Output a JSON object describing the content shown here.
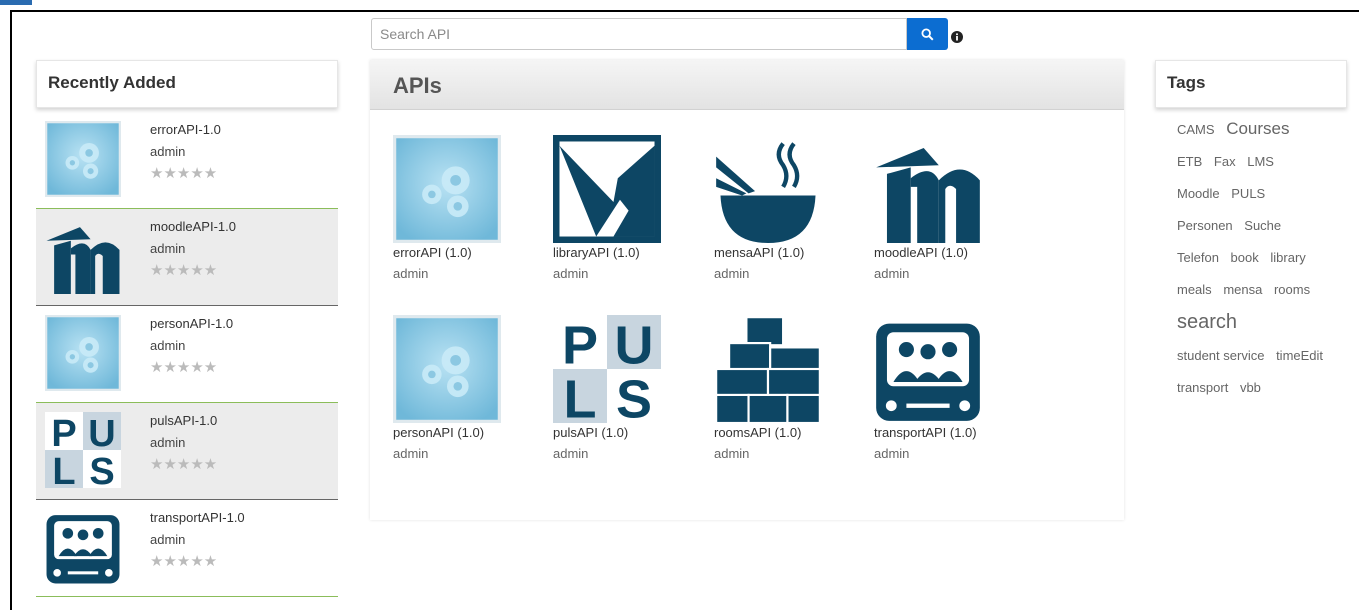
{
  "search": {
    "placeholder": "Search API",
    "button_icon": "search-icon"
  },
  "recent": {
    "title": "Recently Added",
    "items": [
      {
        "name": "errorAPI-1.0",
        "owner": "admin",
        "stars": "★★★★★",
        "icon": "gears"
      },
      {
        "name": "moodleAPI-1.0",
        "owner": "admin",
        "stars": "★★★★★",
        "icon": "moodle"
      },
      {
        "name": "personAPI-1.0",
        "owner": "admin",
        "stars": "★★★★★",
        "icon": "gears"
      },
      {
        "name": "pulsAPI-1.0",
        "owner": "admin",
        "stars": "★★★★★",
        "icon": "puls"
      },
      {
        "name": "transportAPI-1.0",
        "owner": "admin",
        "stars": "★★★★★",
        "icon": "bus"
      }
    ]
  },
  "apis": {
    "title": "APIs",
    "tiles": [
      {
        "name": "errorAPI (1.0)",
        "owner": "admin",
        "icon": "gears"
      },
      {
        "name": "libraryAPI (1.0)",
        "owner": "admin",
        "icon": "library"
      },
      {
        "name": "mensaAPI (1.0)",
        "owner": "admin",
        "icon": "bowl"
      },
      {
        "name": "moodleAPI (1.0)",
        "owner": "admin",
        "icon": "moodle"
      },
      {
        "name": "personAPI (1.0)",
        "owner": "admin",
        "icon": "gears"
      },
      {
        "name": "pulsAPI (1.0)",
        "owner": "admin",
        "icon": "puls"
      },
      {
        "name": "roomsAPI (1.0)",
        "owner": "admin",
        "icon": "rooms"
      },
      {
        "name": "transportAPI (1.0)",
        "owner": "admin",
        "icon": "bus"
      }
    ]
  },
  "tags": {
    "title": "Tags",
    "items": [
      "CAMS",
      "Courses",
      "ETB",
      "Fax",
      "LMS",
      "Moodle",
      "PULS",
      "Personen",
      "Suche",
      "Telefon",
      "book",
      "library",
      "meals",
      "mensa",
      "rooms",
      "search",
      "student service",
      "timeEdit",
      "transport",
      "vbb"
    ]
  },
  "colors": {
    "accent": "#0c6dd1",
    "icon_navy": "#0d4664",
    "gear_bg": "#7fc2e0"
  }
}
